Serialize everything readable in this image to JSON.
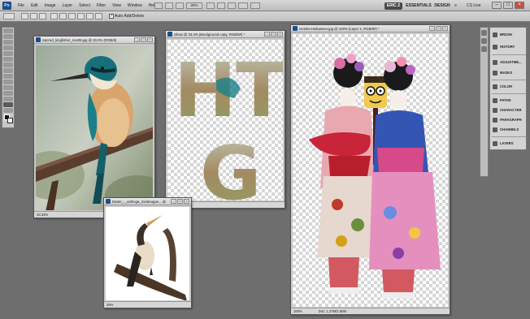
{
  "app": {
    "logo_text": "Ps",
    "menus": [
      "File",
      "Edit",
      "Image",
      "Layer",
      "Select",
      "Filter",
      "View",
      "Window",
      "Help"
    ],
    "zoom": "25%",
    "workspaces": [
      "ERIC Z",
      "ESSENTIALS",
      "DESIGN"
    ],
    "more_workspaces": "»",
    "cs_live": "CS Live",
    "window_buttons": [
      "–",
      "□",
      "×"
    ]
  },
  "options": {
    "auto_label": "Auto Add/Delete",
    "auto_checked": "✓"
  },
  "panels": [
    {
      "label": "BRUSH",
      "icon": "brush-icon"
    },
    {
      "label": "HISTORY",
      "icon": "history-icon"
    },
    {
      "label": "ADJUSTME...",
      "icon": "adjustments-icon"
    },
    {
      "label": "MASKS",
      "icon": "masks-icon"
    },
    {
      "label": "COLOR",
      "icon": "color-icon"
    },
    {
      "label": "PATHS",
      "icon": "paths-icon"
    },
    {
      "label": "CHARACTER",
      "icon": "character-icon"
    },
    {
      "label": "PARAGRAPH",
      "icon": "paragraph-icon"
    },
    {
      "label": "CHANNELS",
      "icon": "channels-icon"
    },
    {
      "label": "LAYERS",
      "icon": "layers-icon"
    }
  ],
  "documents": {
    "kingfisher": {
      "title": "Sacred_kingfisher_nov08.jpg @ 33.3% (RGB/8)",
      "zoom": "33.33%"
    },
    "htg": {
      "title": "Show @ 33.3% (Background copy, RGB/8#) *",
      "letters": [
        "H",
        "T",
        "G"
      ]
    },
    "darter": {
      "title": "Darter_-_anhinga_melanogas... @ 25%",
      "zoom": "25%"
    },
    "geisha": {
      "title": "Geisha-Halloween.jpg @ 100% (Layer 1, RGB/8#) *",
      "zoom": "100%",
      "doc_info": "Doc: 1.27M/2.60M"
    }
  }
}
